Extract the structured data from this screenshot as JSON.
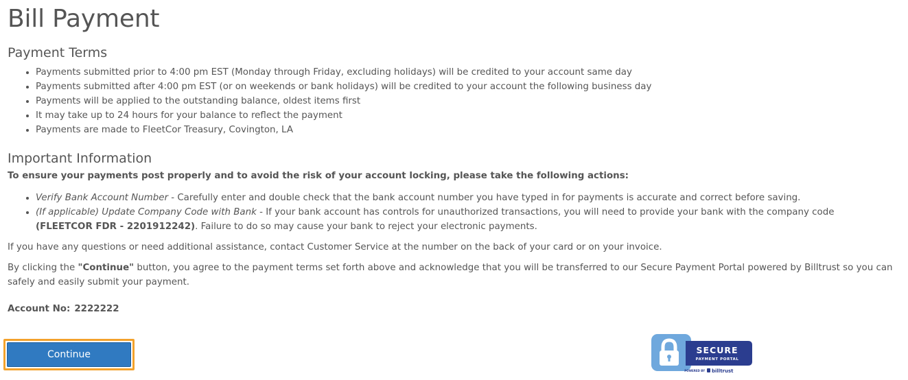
{
  "page": {
    "title": "Bill Payment"
  },
  "payment_terms": {
    "title": "Payment Terms",
    "items": [
      "Payments submitted prior to 4:00 pm EST (Monday through Friday, excluding holidays) will be credited to your account same day",
      "Payments submitted after 4:00 pm EST (or on weekends or bank holidays) will be credited to your account the following business day",
      "Payments will be applied to the outstanding balance, oldest items first",
      "It may take up to 24 hours for your balance to reflect the payment",
      "Payments are made to FleetCor Treasury, Covington, LA"
    ]
  },
  "important_info": {
    "title": "Important Information",
    "lead": "To ensure your payments post properly and to avoid the risk of your account locking, please take the following actions:",
    "actions": [
      {
        "title": "Verify Bank Account Number",
        "text": " - Carefully enter and double check that the bank account number you have typed in for payments is accurate and correct before saving."
      },
      {
        "title": "(If applicable) Update Company Code with Bank",
        "text": " - If your bank account has controls for unauthorized transactions, you will need to provide your bank with the company code ",
        "code": "(FLEETCOR FDR - 2201912242)",
        "text_after": ". Failure to do so may cause your bank to reject your electronic payments."
      }
    ]
  },
  "questions_text": "If you have any questions or need additional assistance, contact Customer Service at the number on the back of your card or on your invoice.",
  "agreement": {
    "prefix": "By clicking the ",
    "button_ref": "\"Continue\"",
    "suffix": " button, you agree to the payment terms set forth above and acknowledge that you will be transferred to our Secure Payment Portal powered by Billtrust so you can safely and easily submit your payment."
  },
  "account": {
    "label": "Account No:",
    "number": "2222222"
  },
  "continue_button": {
    "label": "Continue"
  },
  "secure_badge": {
    "line1": "SECURE",
    "line2": "PAYMENT PORTAL",
    "powered_by": "POWERED BY",
    "brand": "billtrust",
    "icon": "lock-icon"
  },
  "colors": {
    "text": "#555555",
    "button": "#2f7ac0",
    "focus_ring": "#f3a32c",
    "badge_navy": "#2b3d8f",
    "badge_light": "#6fa8dc"
  }
}
